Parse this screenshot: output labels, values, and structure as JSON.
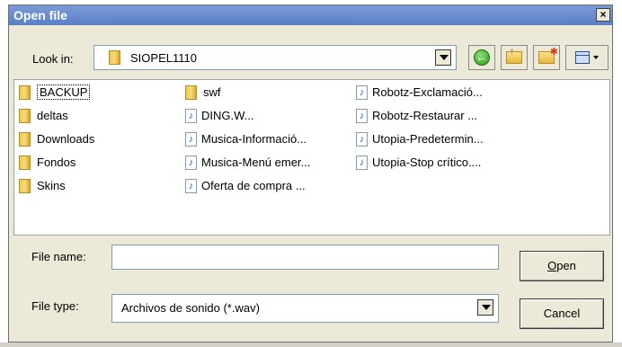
{
  "window": {
    "title": "Open file"
  },
  "look_in": {
    "label": "Look in:",
    "value": "SIOPEL1110"
  },
  "toolbar": {
    "back_icon": "back-arrow-icon",
    "up_icon": "up-folder-icon",
    "new_folder_icon": "new-folder-icon",
    "view_icon": "view-menu-icon"
  },
  "files": {
    "col1": [
      {
        "name": "BACKUP",
        "type": "folder"
      },
      {
        "name": "deltas",
        "type": "folder"
      },
      {
        "name": "Downloads",
        "type": "folder"
      },
      {
        "name": "Fondos",
        "type": "folder"
      },
      {
        "name": "Skins",
        "type": "folder"
      }
    ],
    "col2": [
      {
        "name": "swf",
        "type": "folder"
      },
      {
        "name": "DING.W...",
        "type": "sound"
      },
      {
        "name": "Musica-Informació...",
        "type": "sound"
      },
      {
        "name": "Musica-Menú emer...",
        "type": "sound"
      },
      {
        "name": "Oferta de compra ...",
        "type": "sound"
      }
    ],
    "col3": [
      {
        "name": "Robotz-Exclamació...",
        "type": "sound"
      },
      {
        "name": "Robotz-Restaurar ...",
        "type": "sound"
      },
      {
        "name": "Utopia-Predetermin...",
        "type": "sound"
      },
      {
        "name": "Utopia-Stop crítico....",
        "type": "sound"
      }
    ]
  },
  "file_name": {
    "label": "File name:",
    "value": ""
  },
  "file_type": {
    "label": "File type:",
    "value": "Archivos de sonido (*.wav)"
  },
  "buttons": {
    "open_accel": "O",
    "open_rest": "pen",
    "cancel": "Cancel"
  },
  "colors": {
    "titlebar": "#6a8ccf",
    "dialog_bg": "#ece9d8"
  }
}
